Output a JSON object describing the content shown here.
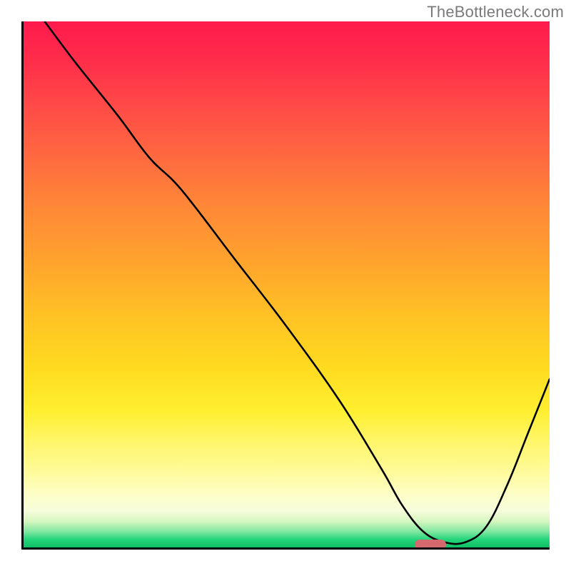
{
  "watermark": "TheBottleneck.com",
  "chart_data": {
    "type": "line",
    "title": "",
    "xlabel": "",
    "ylabel": "",
    "xlim": [
      0,
      100
    ],
    "ylim": [
      0,
      100
    ],
    "grid": false,
    "legend": false,
    "gradient_stops": [
      {
        "pos": 0,
        "color": "#ff1a4d"
      },
      {
        "pos": 8,
        "color": "#ff2f4a"
      },
      {
        "pos": 16,
        "color": "#ff4a47"
      },
      {
        "pos": 26,
        "color": "#ff6a3f"
      },
      {
        "pos": 36,
        "color": "#ff8a36"
      },
      {
        "pos": 46,
        "color": "#ffa42d"
      },
      {
        "pos": 56,
        "color": "#ffc224"
      },
      {
        "pos": 66,
        "color": "#ffdb20"
      },
      {
        "pos": 74,
        "color": "#ffef30"
      },
      {
        "pos": 80,
        "color": "#fff66a"
      },
      {
        "pos": 86,
        "color": "#fffb9e"
      },
      {
        "pos": 90,
        "color": "#fdfec8"
      },
      {
        "pos": 93,
        "color": "#f6fddb"
      },
      {
        "pos": 95,
        "color": "#d7f6c0"
      },
      {
        "pos": 97,
        "color": "#7fe8a0"
      },
      {
        "pos": 98.5,
        "color": "#22d47a"
      },
      {
        "pos": 100,
        "color": "#0fbf66"
      }
    ],
    "series": [
      {
        "name": "bottleneck-curve",
        "x": [
          4,
          10,
          18,
          24,
          30,
          40,
          50,
          60,
          68,
          72,
          76,
          80,
          84,
          88,
          92,
          96,
          100
        ],
        "y": [
          100,
          92,
          82,
          74,
          68,
          55,
          42,
          28,
          15,
          8,
          3,
          1,
          1,
          4,
          12,
          22,
          32
        ]
      }
    ],
    "marker": {
      "x": 77,
      "y": 1,
      "color": "#d46a6f"
    },
    "axes": {
      "left": true,
      "bottom": true,
      "ticks": false
    }
  }
}
